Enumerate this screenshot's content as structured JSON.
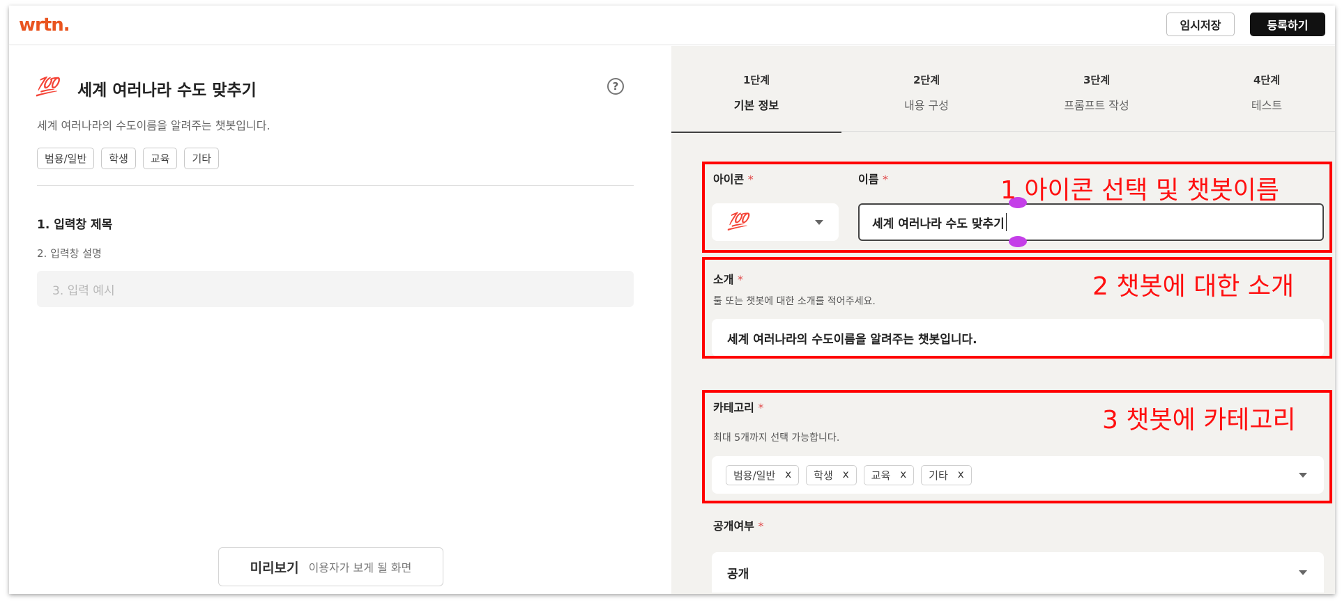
{
  "header": {
    "logo": "wrtn.",
    "save_label": "임시저장",
    "register_label": "등록하기"
  },
  "preview": {
    "icon": "💯",
    "title": "세계 여러나라 수도 맞추기",
    "help": "?",
    "description": "세계 여러나라의 수도이름을 알려주는 챗봇입니다.",
    "tags": [
      "범용/일반",
      "학생",
      "교육",
      "기타"
    ],
    "field1": "1. 입력창 제목",
    "field2": "2. 입력창 설명",
    "example": "3. 입력 예시",
    "preview_button": "미리보기",
    "preview_sub": "이용자가 보게 될 화면"
  },
  "steps": [
    {
      "num": "1단계",
      "label": "기본 정보"
    },
    {
      "num": "2단계",
      "label": "내용 구성"
    },
    {
      "num": "3단계",
      "label": "프롬프트 작성"
    },
    {
      "num": "4단계",
      "label": "테스트"
    }
  ],
  "form": {
    "icon_label": "아이콘",
    "icon_value": "💯",
    "name_label": "이름",
    "name_value": "세계 여러나라 수도 맞추기",
    "required_mark": "*",
    "intro_label": "소개",
    "intro_help": "툴 또는 챗봇에 대한 소개를 적어주세요.",
    "intro_value": "세계 여러나라의 수도이름을 알려주는 챗봇입니다.",
    "category_label": "카테고리",
    "category_help": "최대 5개까지 선택 가능합니다.",
    "category_chips": [
      "범용/일반",
      "학생",
      "교육",
      "기타"
    ],
    "chip_remove": "x",
    "public_label": "공개여부",
    "public_value": "공개"
  },
  "annotations": {
    "note1": "1 아이콘 선택 및 챗봇이름",
    "note2": "2 챗봇에 대한 소개",
    "note3": "3 챗봇에 카테고리",
    "color": "#ff0000"
  },
  "colors": {
    "brand": "#e9541f",
    "required": "#e04848",
    "right_panel_bg": "#f3f2ef",
    "cursor_handle": "#c43fe8"
  }
}
